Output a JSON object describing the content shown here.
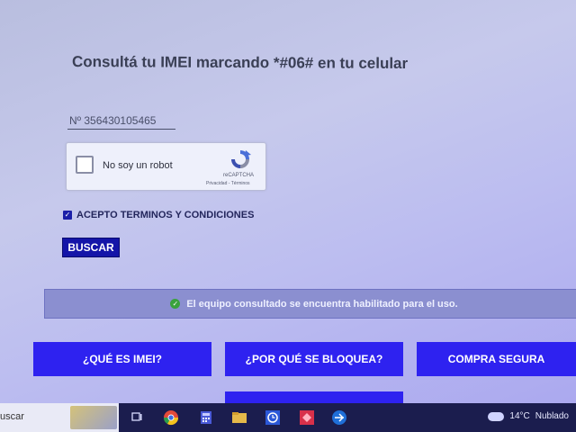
{
  "heading": "Consultá tu IMEI marcando *#06# en tu celular",
  "imei_value": "Nº 356430105465",
  "captcha": {
    "label": "No soy un robot",
    "brand": "reCAPTCHA",
    "links": "Privacidad - Términos"
  },
  "terms": {
    "checked": true,
    "label": "ACEPTO TERMINOS Y CONDICIONES"
  },
  "search_button": "BUSCAR",
  "status": {
    "message": "El equipo consultado se encuentra habilitado para el uso.",
    "color": "#3aa23c"
  },
  "nav_buttons": [
    "¿QUÉ ES IMEI?",
    "¿POR QUÉ SE BLOQUEA?",
    "COMPRA SEGURA"
  ],
  "taskbar": {
    "search_text": "uscar",
    "pinned_icons": [
      "task-view-icon",
      "chrome-icon",
      "calculator-icon",
      "file-explorer-icon",
      "clock-app-icon",
      "app-red-icon",
      "app-blue-icon"
    ],
    "weather": {
      "temp": "14°C",
      "condition": "Nublado"
    }
  },
  "colors": {
    "primary": "#2e22f0",
    "search_button": "#1415a8",
    "status_bar": "#8b8fd0"
  }
}
